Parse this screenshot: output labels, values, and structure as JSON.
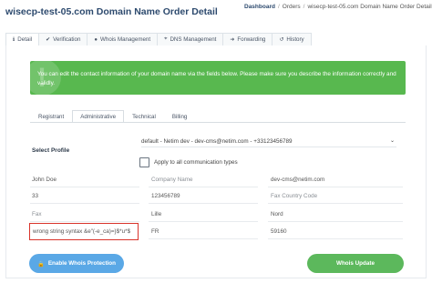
{
  "page": {
    "title": "wisecp-test-05.com Domain Name Order Detail"
  },
  "breadcrumb": {
    "items": [
      "Dashboard",
      "Orders",
      "wisecp-test-05.com Domain Name Order Detail"
    ]
  },
  "tabs": [
    {
      "label": "Detail",
      "icon": "info-icon"
    },
    {
      "label": "Verification",
      "icon": "check-icon"
    },
    {
      "label": "Whois Management",
      "icon": "users-icon"
    },
    {
      "label": "DNS Management",
      "icon": "dns-icon"
    },
    {
      "label": "Forwarding",
      "icon": "forward-icon"
    },
    {
      "label": "History",
      "icon": "history-icon"
    }
  ],
  "banner": {
    "message": "You can edit the contact information of your domain name via the fields below. Please make sure you describe the information correctly and validly.",
    "color": "#58b84f"
  },
  "contact_tabs": [
    "Registrant",
    "Administrative",
    "Technical",
    "Billing"
  ],
  "profile": {
    "label": "Select Profile",
    "selected": "default - Netim dev - dev-cms@netim.com - +33123456789"
  },
  "apply_all": {
    "label": "Apply to all communication types",
    "checked": false
  },
  "fields": {
    "name": "John Doe",
    "company_placeholder": "Company Name",
    "email": "dev-cms@netim.com",
    "phone_code": "33",
    "phone": "123456789",
    "fax_code_placeholder": "Fax Country Code",
    "fax_placeholder": "Fax",
    "city": "Lille",
    "state": "Nord",
    "address": "wrong string syntax &e\"(-e_ca)=}$*u*$",
    "country": "FR",
    "zip": "59160"
  },
  "buttons": {
    "enable_whois": "Enable Whois Protection",
    "whois_update": "Whois Update"
  },
  "colors": {
    "title": "#2d4a6e",
    "error_border": "#d9342b",
    "primary_button": "#5aa8e6",
    "success_button": "#5cb85c"
  }
}
